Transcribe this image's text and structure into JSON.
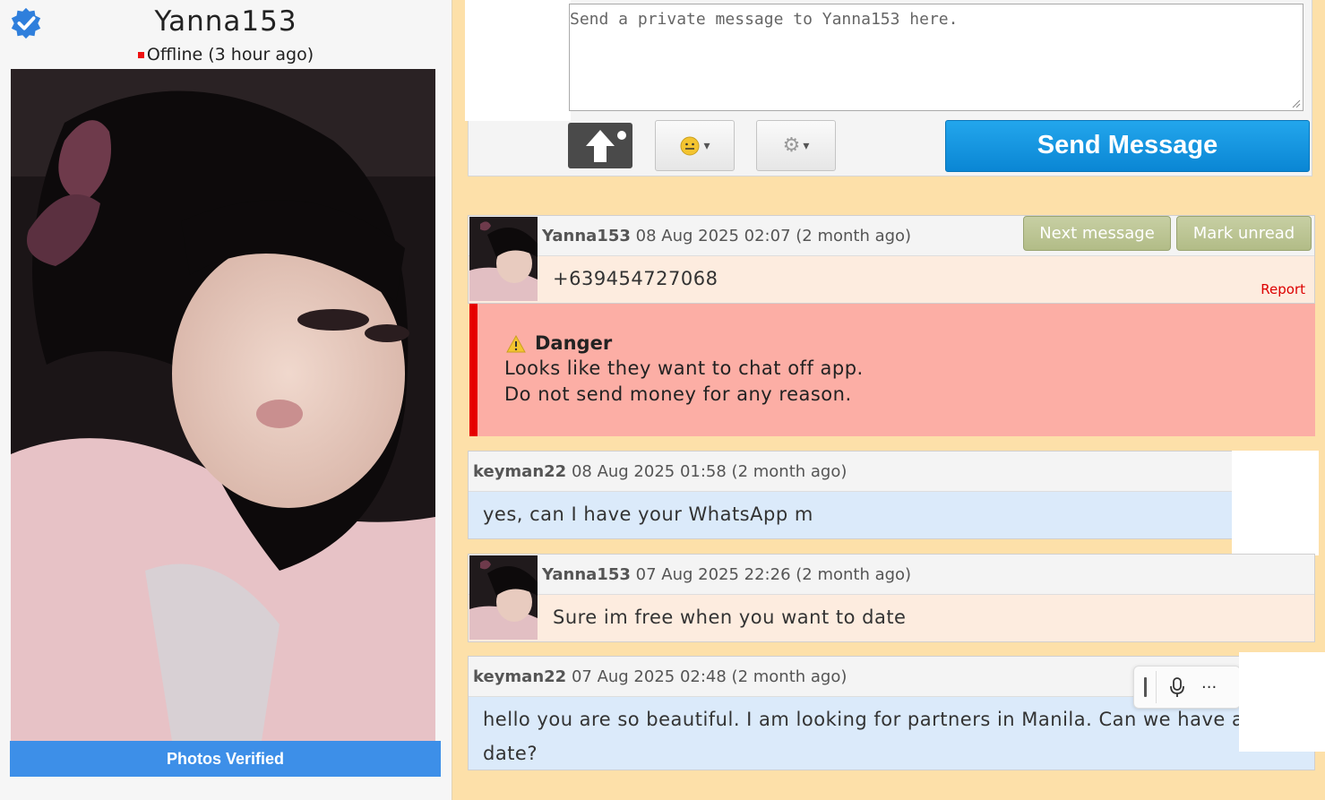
{
  "profile": {
    "username": "Yanna153",
    "status": "Offline (3 hour ago)",
    "photos_verified": "Photos Verified"
  },
  "compose": {
    "placeholder": "Send a private message to Yanna153 here.",
    "send_label": "Send Message",
    "emoji_icon": "smiley-icon",
    "settings_icon": "gear-icon",
    "upload_icon": "camera-upload-icon"
  },
  "actions": {
    "next_message": "Next message",
    "mark_unread": "Mark unread",
    "report": "Report"
  },
  "messages": [
    {
      "sender": "Yanna153",
      "date": "08 Aug 2025 02:07 (2 month ago)",
      "text": "+639454727068"
    },
    {
      "sender": "keyman22",
      "date": "08 Aug 2025 01:58 (2 month ago)",
      "text": "yes, can I have your WhatsApp m"
    },
    {
      "sender": "Yanna153",
      "date": "07 Aug 2025 22:26 (2 month ago)",
      "text": "Sure im free when you want to date"
    },
    {
      "sender": "keyman22",
      "date": "07 Aug 2025 02:48 (2 month ago)",
      "text_line1": "hello you are so beautiful. I am looking for partners in Manila. Can we have a",
      "text_line2": "date?"
    }
  ],
  "danger": {
    "title": "Danger",
    "line1": "Looks like they want to chat off app.",
    "line2": "Do not send money for any reason."
  },
  "colors": {
    "page_bg": "#fde0a9",
    "send_blue": "#0a86d4",
    "verified_blue": "#3d8fe8",
    "danger_red": "#e60000",
    "danger_bg": "#fcaea5"
  }
}
